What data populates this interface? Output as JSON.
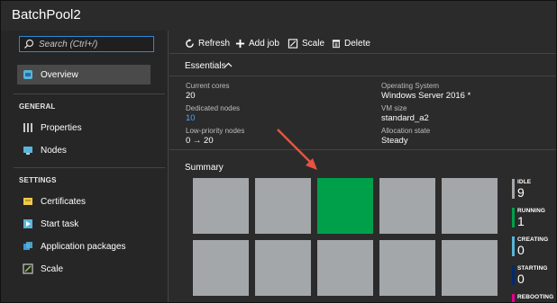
{
  "window": {
    "title": "BatchPool2"
  },
  "sidebar": {
    "search_placeholder": "Search (Ctrl+/)",
    "overview_label": "Overview",
    "sections": [
      {
        "label": "GENERAL",
        "items": [
          {
            "label": "Properties"
          },
          {
            "label": "Nodes"
          }
        ]
      },
      {
        "label": "SETTINGS",
        "items": [
          {
            "label": "Certificates"
          },
          {
            "label": "Start task"
          },
          {
            "label": "Application packages"
          },
          {
            "label": "Scale"
          }
        ]
      }
    ]
  },
  "toolbar": {
    "refresh": "Refresh",
    "add_job": "Add job",
    "scale": "Scale",
    "delete": "Delete"
  },
  "essentials": {
    "label": "Essentials",
    "left": [
      {
        "label": "Current cores",
        "value": "20"
      },
      {
        "label": "Dedicated nodes",
        "value": "10"
      },
      {
        "label": "Low-priority nodes",
        "value": "0 → 20"
      }
    ],
    "right": [
      {
        "label": "Operating System",
        "value": "Windows Server 2016 *"
      },
      {
        "label": "VM size",
        "value": "standard_a2"
      },
      {
        "label": "Allocation state",
        "value": "Steady"
      }
    ]
  },
  "summary": {
    "title": "Summary",
    "tiles_row1": [
      "idle",
      "idle",
      "running",
      "idle",
      "idle"
    ],
    "tiles_row2": [
      "idle",
      "idle",
      "idle",
      "idle",
      "idle"
    ],
    "legend": [
      {
        "label": "IDLE",
        "count": "9",
        "color": "#a3a7aa"
      },
      {
        "label": "RUNNING",
        "count": "1",
        "color": "#00a04a"
      },
      {
        "label": "CREATING",
        "count": "0",
        "color": "#59b4d9"
      },
      {
        "label": "STARTING",
        "count": "0",
        "color": "#002a6c"
      },
      {
        "label": "REBOOTING",
        "count": "",
        "color": "#e3008c"
      }
    ]
  },
  "colors": {
    "accent": "#2b88d8",
    "link": "#4aa3ff",
    "annotation_arrow": "#e8533f"
  }
}
